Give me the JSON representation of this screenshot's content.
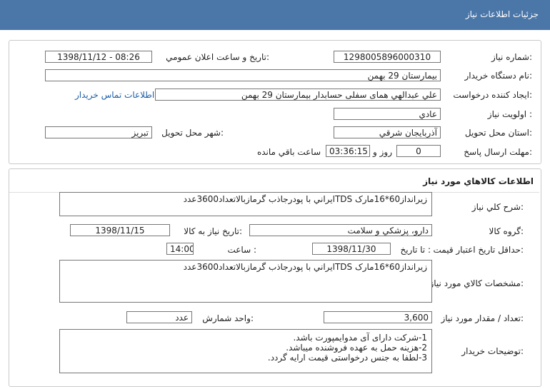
{
  "header": {
    "title": "جزئيات اطلاعات نياز"
  },
  "need_info": {
    "need_number_label": "شماره نياز:",
    "need_number": "1298005896000310",
    "announce_label": "تاريخ و ساعت اعلان عمومي:",
    "announce_value": "1398/11/12 - 08:26",
    "buyer_label": "نام دستگاه خريدار:",
    "buyer": "بيمارستان 29 بهمن",
    "creator_label": "ايجاد کننده درخواست:",
    "creator": "علي عبدالهي همای سفلی حسابدار بيمارستان 29 بهمن",
    "contact_link": "اطلاعات تماس خريدار",
    "priority_label": "اولويت نياز :",
    "priority": "عادي",
    "province_label": "استان محل تحويل:",
    "province": "آذربايجان شرقي",
    "city_label": "شهر محل تحويل:",
    "city": "تبريز",
    "deadline_label": "مهلت ارسال پاسخ:",
    "days": "0",
    "days_label": "روز و",
    "time_left": "03:36:15",
    "remaining_label": "ساعت باقي مانده"
  },
  "goods": {
    "title": "اطلاعات کالاهاي مورد نياز",
    "summary_label": "شرح کلي نياز:",
    "summary": "زيرانداز60*16مارک TDSايراني با پودرجاذب گرمازبالاتعداد3600عدد",
    "group_label": "گروه کالا:",
    "group": "دارو، پزشکي و سلامت",
    "need_date_label": "تاريخ نياز به کالا:",
    "need_date": "1398/11/15",
    "validity_label": "حداقل تاريخ اعتبار قيمت:",
    "until_date_label": "تا تاريخ :",
    "until_date": "1398/11/30",
    "hour_label": "ساعت :",
    "hour": "14:00",
    "spec_label": "مشخصات کالاي مورد نياز:",
    "spec": "زيرانداز60*16مارک TDSايراني با پودرجاذب گرمازبالاتعداد3600عدد",
    "qty_label": "تعداد / مقدار مورد نياز:",
    "qty": "3,600",
    "unit_label": "واحد شمارش:",
    "unit": "عدد",
    "desc_label": "توضيحات خريدار:",
    "desc_lines": [
      "1-شرکت دارای آی مدوایمپورت باشد.",
      "2-هزينه حمل به عهده فروشنده ميباشد.",
      "3-لطفا به جنس درخواستی قيمت ارايه گردد."
    ]
  }
}
